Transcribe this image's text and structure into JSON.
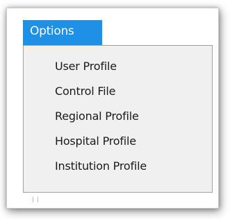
{
  "menu": {
    "title": "Options",
    "items": [
      {
        "label": "User Profile"
      },
      {
        "label": "Control File"
      },
      {
        "label": "Regional Profile"
      },
      {
        "label": "Hospital Profile"
      },
      {
        "label": "Institution Profile"
      }
    ]
  },
  "colors": {
    "accent": "#1e90e6",
    "dropdown_bg": "#f0f0f0",
    "border": "#a0a0a0"
  }
}
